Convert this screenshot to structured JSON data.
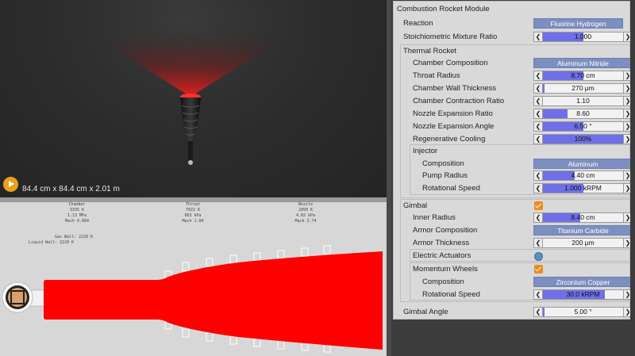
{
  "viewport": {
    "dimensions": "84.4 cm x 84.4 cm x 2.01 m"
  },
  "section": {
    "chamber": {
      "title": "Chamber",
      "temp": "3335 K",
      "pressure": "1.13 MPa",
      "mach": "Mach 0.664"
    },
    "throat": {
      "title": "Throat",
      "temp": "7022 K",
      "pressure": "663 kPa",
      "mach": "Mach 1.00"
    },
    "nozzle": {
      "title": "Nozzle",
      "temp": "2050 K",
      "pressure": "4.02 kPa",
      "mach": "Mach 3.74"
    },
    "gas_wall": "Gas Wall: 2220 K",
    "liquid_wall": "Liquid Wall: 2220 K",
    "flame_color": "#ff0000"
  },
  "panel": {
    "module_title": "Combustion Rocket Module",
    "reaction": {
      "label": "Reaction",
      "value": "Fluorine Hydrogen"
    },
    "mixture": {
      "label": "Stoichiometric Mixture Ratio",
      "value": "1.000",
      "fill": 0.5
    },
    "thermal": {
      "title": "Thermal Rocket",
      "composition": {
        "label": "Chamber Composition",
        "value": "Aluminum Nitride"
      },
      "throat_radius": {
        "label": "Throat Radius",
        "value": "8.70 cm",
        "fill": 0.5
      },
      "wall_thickness": {
        "label": "Chamber Wall Thickness",
        "value": "270 μm",
        "fill": 0.02
      },
      "contraction": {
        "label": "Chamber Contraction Ratio",
        "value": "1.10",
        "fill": 0.0
      },
      "expansion_ratio": {
        "label": "Nozzle Expansion Ratio",
        "value": "8.60",
        "fill": 0.31
      },
      "expansion_angle": {
        "label": "Nozzle Expansion Angle",
        "value": "6.50 °",
        "fill": 0.5
      },
      "cooling": {
        "label": "Regenerative Cooling",
        "value": "100%",
        "fill": 1.0
      }
    },
    "injector": {
      "title": "Injector",
      "composition": {
        "label": "Composition",
        "value": "Aluminum"
      },
      "pump_radius": {
        "label": "Pump Radius",
        "value": "4.40 cm",
        "fill": 0.4
      },
      "speed": {
        "label": "Rotational Speed",
        "value": "1.000 kRPM",
        "fill": 0.5
      }
    },
    "gimbal": {
      "title": "Gimbal",
      "inner_radius": {
        "label": "Inner Radius",
        "value": "8.40 cm",
        "fill": 0.47
      },
      "armor_comp": {
        "label": "Armor Composition",
        "value": "Titanium Carbide"
      },
      "armor_thick": {
        "label": "Armor Thickness",
        "value": "200 μm",
        "fill": 0.0
      },
      "actuators": {
        "label": "Electric Actuators"
      },
      "wheels": {
        "label": "Momentum Wheels"
      },
      "wheel_comp": {
        "label": "Composition",
        "value": "Zirconium Copper"
      },
      "wheel_speed": {
        "label": "Rotational Speed",
        "value": "30.0 kRPM",
        "fill": 0.77
      }
    },
    "gimbal_angle": {
      "label": "Gimbal Angle",
      "value": "5.00 °",
      "fill": 0.02
    }
  }
}
